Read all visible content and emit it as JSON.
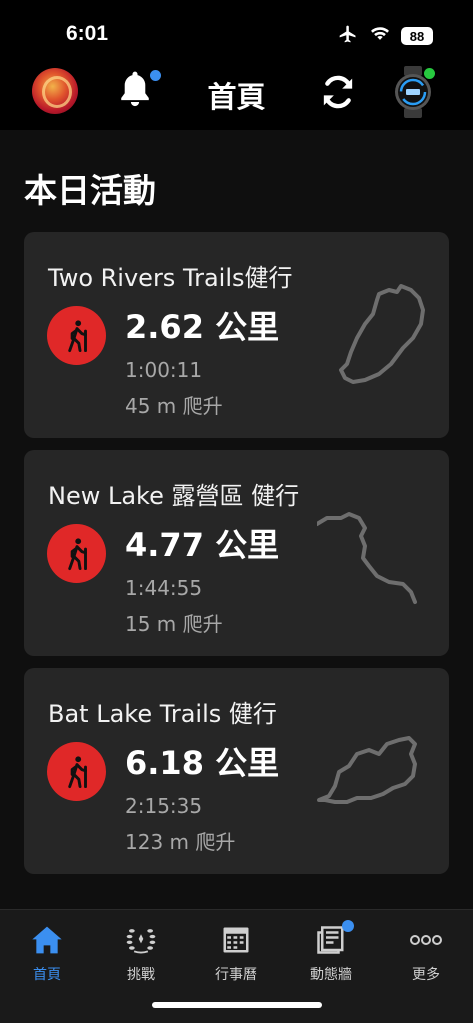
{
  "status_bar": {
    "time": "6:01",
    "battery": "88"
  },
  "header": {
    "title": "首頁"
  },
  "section": {
    "title": "本日活動"
  },
  "activities": [
    {
      "title": "Two Rivers Trails健行",
      "distance": "2.62 公里",
      "duration": "1:00:11",
      "ascent": "45 m 爬升"
    },
    {
      "title": "New Lake 露營區 健行",
      "distance": "4.77 公里",
      "duration": "1:44:55",
      "ascent": "15 m 爬升"
    },
    {
      "title": "Bat Lake Trails 健行",
      "distance": "6.18 公里",
      "duration": "2:15:35",
      "ascent": "123 m 爬升"
    }
  ],
  "tabs": [
    {
      "label": "首頁",
      "icon": "home-icon",
      "active": true
    },
    {
      "label": "挑戰",
      "icon": "laurel-icon"
    },
    {
      "label": "行事曆",
      "icon": "calendar-icon"
    },
    {
      "label": "動態牆",
      "icon": "newsfeed-icon",
      "badge": true
    },
    {
      "label": "更多",
      "icon": "more-icon"
    }
  ],
  "colors": {
    "accent": "#3b8ff0",
    "activity_red": "#e02828",
    "card_bg": "#262626",
    "watch_status": "#27c93f"
  }
}
